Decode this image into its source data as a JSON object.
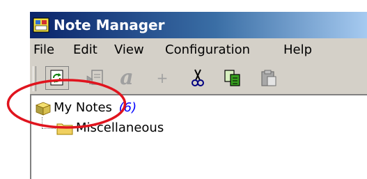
{
  "window": {
    "title": "Note Manager"
  },
  "menubar": {
    "items": [
      "File",
      "Edit",
      "View",
      "Configuration",
      "Help"
    ]
  },
  "toolbar": {
    "buttons": [
      {
        "icon": "refresh-icon",
        "enabled": true
      },
      {
        "icon": "note-cursor-icon",
        "enabled": false
      },
      {
        "icon": "font-icon",
        "enabled": false
      },
      {
        "icon": "plus-icon",
        "enabled": false
      },
      {
        "icon": "cut-icon",
        "enabled": true
      },
      {
        "icon": "copy-icon",
        "enabled": true
      },
      {
        "icon": "paste-icon",
        "enabled": false
      }
    ],
    "font_glyph": "a",
    "plus_glyph": "+"
  },
  "tree": {
    "root": {
      "label": "My Notes",
      "count": "(6)"
    },
    "children": [
      {
        "label": "Miscellaneous"
      }
    ]
  },
  "colors": {
    "title_gradient_start": "#0a246a",
    "title_gradient_end": "#a6caf0",
    "annotation": "#e0141e",
    "count": "#0000ff"
  }
}
